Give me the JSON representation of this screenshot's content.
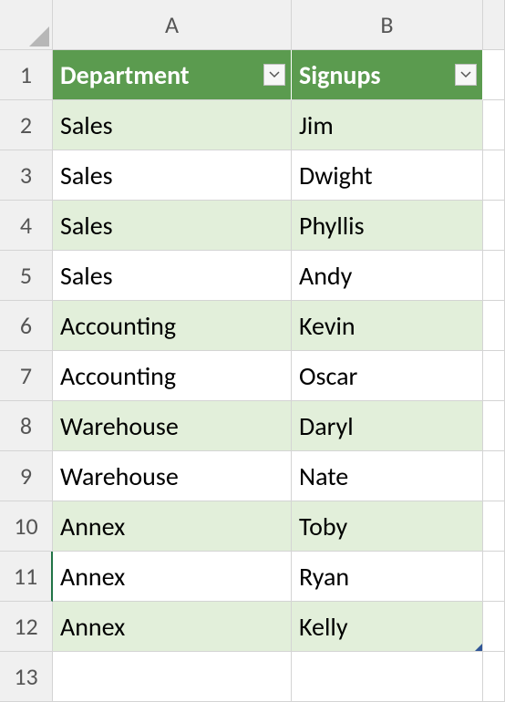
{
  "columns": [
    "A",
    "B"
  ],
  "rows": [
    "1",
    "2",
    "3",
    "4",
    "5",
    "6",
    "7",
    "8",
    "9",
    "10",
    "11",
    "12",
    "13"
  ],
  "headers": {
    "col1": "Department",
    "col2": "Signups"
  },
  "table": [
    {
      "dept": "Sales",
      "signup": "Jim"
    },
    {
      "dept": "Sales",
      "signup": "Dwight"
    },
    {
      "dept": "Sales",
      "signup": "Phyllis"
    },
    {
      "dept": "Sales",
      "signup": "Andy"
    },
    {
      "dept": "Accounting",
      "signup": "Kevin"
    },
    {
      "dept": "Accounting",
      "signup": "Oscar"
    },
    {
      "dept": "Warehouse",
      "signup": "Daryl"
    },
    {
      "dept": "Warehouse",
      "signup": "Nate"
    },
    {
      "dept": "Annex",
      "signup": "Toby"
    },
    {
      "dept": "Annex",
      "signup": "Ryan"
    },
    {
      "dept": "Annex",
      "signup": "Kelly"
    }
  ],
  "chart_data": {
    "type": "table",
    "columns": [
      "Department",
      "Signups"
    ],
    "rows": [
      [
        "Sales",
        "Jim"
      ],
      [
        "Sales",
        "Dwight"
      ],
      [
        "Sales",
        "Phyllis"
      ],
      [
        "Sales",
        "Andy"
      ],
      [
        "Accounting",
        "Kevin"
      ],
      [
        "Accounting",
        "Oscar"
      ],
      [
        "Warehouse",
        "Daryl"
      ],
      [
        "Warehouse",
        "Nate"
      ],
      [
        "Annex",
        "Toby"
      ],
      [
        "Annex",
        "Ryan"
      ],
      [
        "Annex",
        "Kelly"
      ]
    ]
  }
}
